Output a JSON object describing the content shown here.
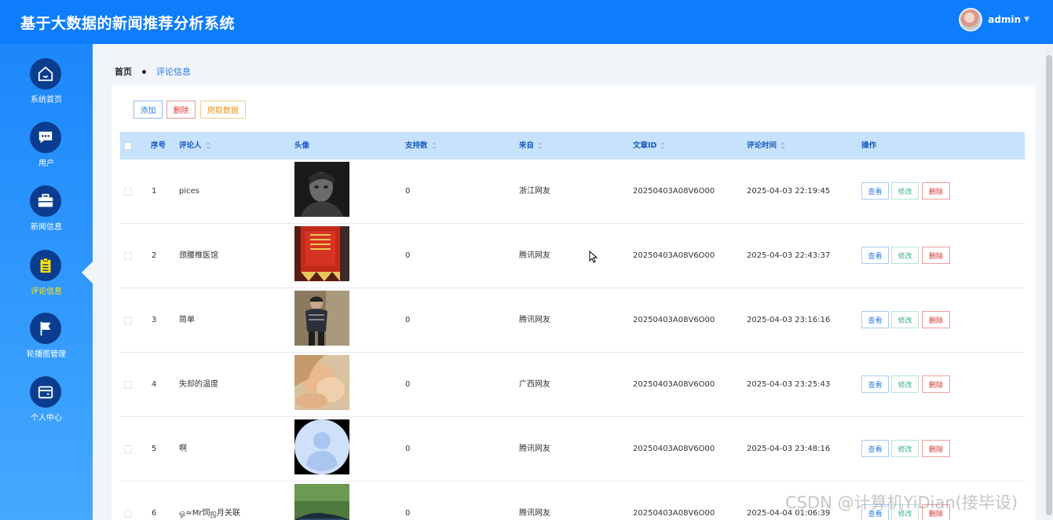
{
  "app": {
    "title": "基于大数据的新闻推荐分析系统"
  },
  "user": {
    "name": "admin"
  },
  "sidebar": {
    "items": [
      {
        "label": "系统首页",
        "icon": "home-icon"
      },
      {
        "label": "用户",
        "icon": "chat-icon"
      },
      {
        "label": "新闻信息",
        "icon": "briefcase-icon"
      },
      {
        "label": "评论信息",
        "icon": "clipboard-icon",
        "active": true
      },
      {
        "label": "轮播图管理",
        "icon": "flag-icon"
      },
      {
        "label": "个人中心",
        "icon": "wallet-icon"
      }
    ]
  },
  "breadcrumb": {
    "home": "首页",
    "current": "评论信息"
  },
  "toolbar": {
    "add": "添加",
    "delete": "删除",
    "crawl": "爬取数据"
  },
  "table": {
    "headers": {
      "index": "序号",
      "commenter": "评论人",
      "avatar": "头像",
      "support": "支持数",
      "source": "来自",
      "article_id": "文章ID",
      "time": "评论时间",
      "actions": "操作"
    },
    "actions": {
      "view": "查看",
      "edit": "修改",
      "delete": "删除"
    },
    "rows": [
      {
        "index": "1",
        "commenter": "pices",
        "support": "0",
        "source": "浙江网友",
        "article_id": "20250403A08V6O00",
        "time": "2025-04-03 22:19:45"
      },
      {
        "index": "2",
        "commenter": "颈腰椎医馆",
        "support": "0",
        "source": "腾讯网友",
        "article_id": "20250403A08V6O00",
        "time": "2025-04-03 22:43:37"
      },
      {
        "index": "3",
        "commenter": "简单",
        "support": "0",
        "source": "腾讯网友",
        "article_id": "20250403A08V6O00",
        "time": "2025-04-03 23:16:16"
      },
      {
        "index": "4",
        "commenter": "失却的温度",
        "support": "0",
        "source": "广西网友",
        "article_id": "20250403A08V6O00",
        "time": "2025-04-03 23:25:43"
      },
      {
        "index": "5",
        "commenter": "啊",
        "support": "0",
        "source": "腾讯网友",
        "article_id": "20250403A08V6O00",
        "time": "2025-04-03 23:48:16"
      },
      {
        "index": "6",
        "commenter": "ஓ≈Mr饲ஜ月关联",
        "support": "0",
        "source": "腾讯网友",
        "article_id": "20250403A08V6O00",
        "time": "2025-04-04 01:06:39"
      }
    ]
  },
  "watermark": "CSDN @计算机YiDian(接毕设)",
  "colors": {
    "topbar": "#0d7dfb",
    "sidebar": "#1b87fb",
    "header_row": "#c7e2fd",
    "active_label": "#ffe600"
  }
}
